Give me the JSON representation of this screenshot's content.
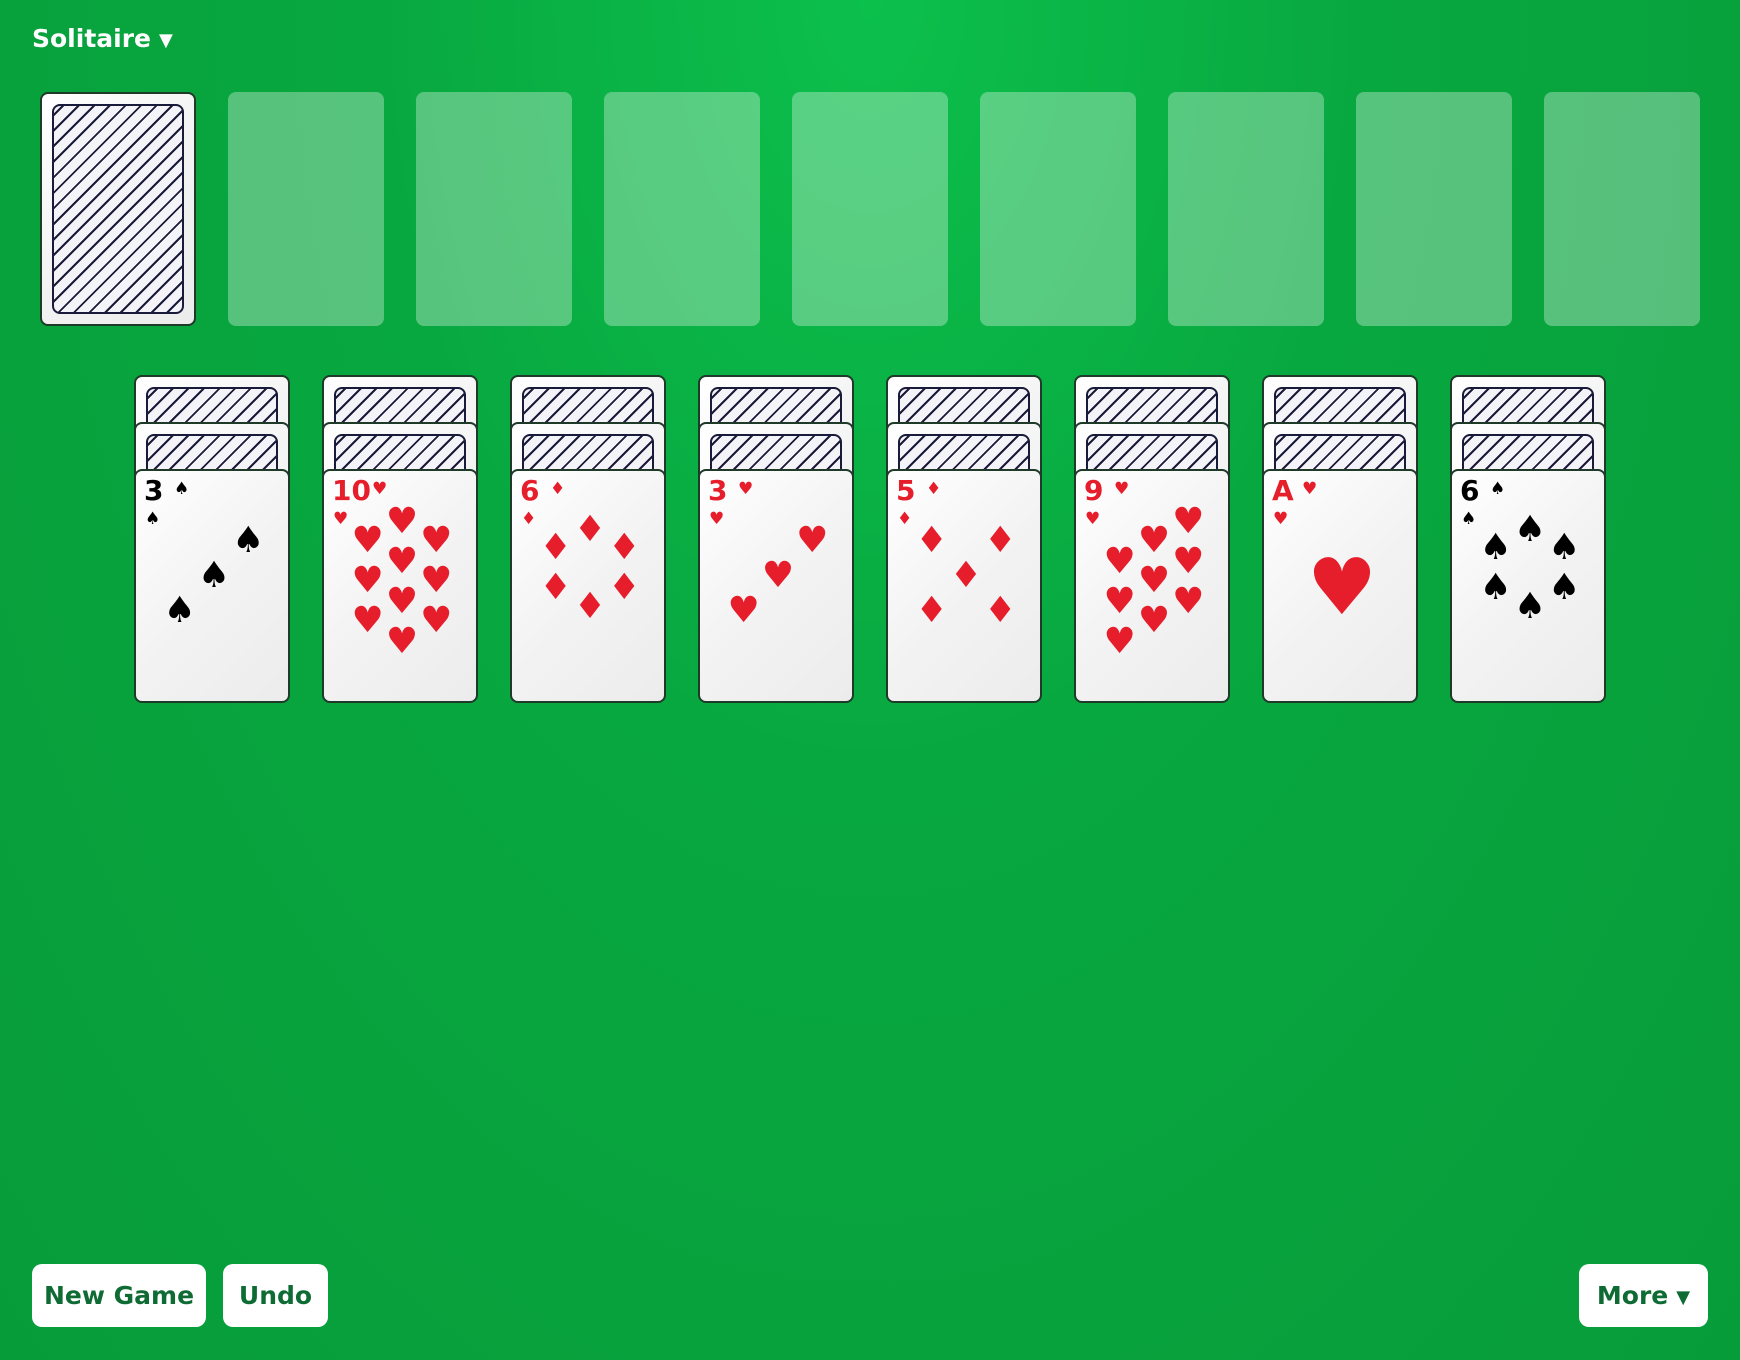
{
  "header": {
    "title": "Solitaire",
    "dropdown_icon": "▼"
  },
  "stock": {
    "face": "down"
  },
  "foundations": [
    {
      "state": "empty"
    },
    {
      "state": "empty"
    },
    {
      "state": "empty"
    },
    {
      "state": "empty"
    },
    {
      "state": "empty"
    },
    {
      "state": "empty"
    },
    {
      "state": "empty"
    },
    {
      "state": "empty"
    }
  ],
  "tableau": [
    {
      "face_down": 2,
      "top": {
        "rank": "3",
        "suit": "♠",
        "color": "black"
      }
    },
    {
      "face_down": 2,
      "top": {
        "rank": "10",
        "suit": "♥",
        "color": "red"
      }
    },
    {
      "face_down": 2,
      "top": {
        "rank": "6",
        "suit": "♦",
        "color": "red"
      }
    },
    {
      "face_down": 2,
      "top": {
        "rank": "3",
        "suit": "♥",
        "color": "red"
      }
    },
    {
      "face_down": 2,
      "top": {
        "rank": "5",
        "suit": "♦",
        "color": "red"
      }
    },
    {
      "face_down": 2,
      "top": {
        "rank": "9",
        "suit": "♥",
        "color": "red"
      }
    },
    {
      "face_down": 2,
      "top": {
        "rank": "A",
        "suit": "♥",
        "color": "red"
      }
    },
    {
      "face_down": 2,
      "top": {
        "rank": "6",
        "suit": "♠",
        "color": "black"
      }
    }
  ],
  "buttons": {
    "new_game": "New Game",
    "undo": "Undo",
    "more": "More",
    "more_icon": "▼"
  },
  "colors": {
    "felt": "#08a840",
    "red_suit": "#e61e2b",
    "button_text": "#0e6b34"
  }
}
